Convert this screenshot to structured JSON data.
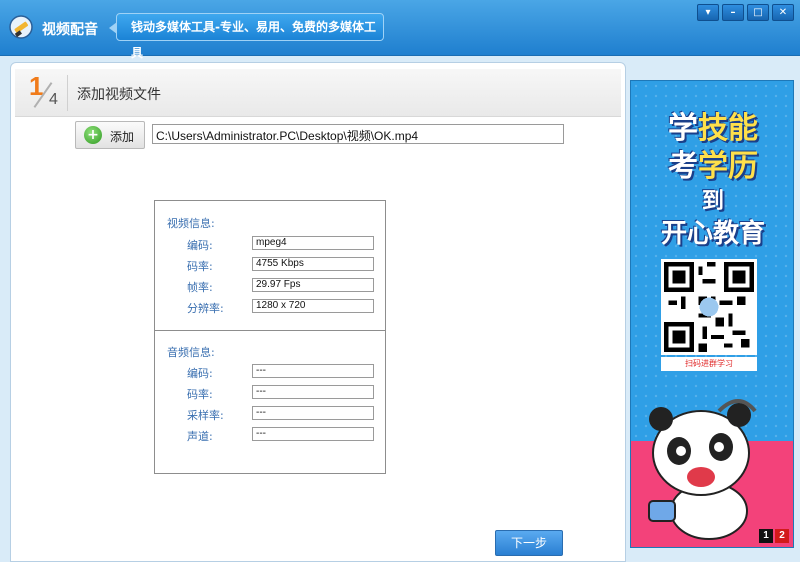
{
  "titlebar": {
    "app_title": "视频配音",
    "slogan": "钱动多媒体工具-专业、易用、免费的多媒体工具",
    "buttons": {
      "menu": "▾",
      "minimize": "–",
      "maximize": "□",
      "close": "✕"
    }
  },
  "step": {
    "current": "1",
    "total": "4",
    "title": "添加视频文件"
  },
  "add_button": {
    "label": "添加",
    "icon": "plus-icon"
  },
  "file_path": "C:\\Users\\Administrator.PC\\Desktop\\视频\\OK.mp4",
  "video_info": {
    "title": "视频信息:",
    "rows": [
      {
        "label": "编码:",
        "value": "mpeg4"
      },
      {
        "label": "码率:",
        "value": "4755 Kbps"
      },
      {
        "label": "帧率:",
        "value": "29.97 Fps"
      },
      {
        "label": "分辨率:",
        "value": "1280 x 720"
      }
    ]
  },
  "audio_info": {
    "title": "音频信息:",
    "rows": [
      {
        "label": "编码:",
        "value": "---"
      },
      {
        "label": "码率:",
        "value": "---"
      },
      {
        "label": "采样率:",
        "value": "---"
      },
      {
        "label": "声道:",
        "value": "---"
      }
    ]
  },
  "next_button": "下一步",
  "ad": {
    "line1_a": "学",
    "line1_b": "技能",
    "line2_a": "考",
    "line2_b": "学历",
    "line3": "到",
    "line4": "开心教育",
    "qr_caption": "扫码进群学习",
    "pages": [
      "1",
      "2"
    ]
  },
  "colors": {
    "accent": "#1f7fcf",
    "step_orange": "#f07b1a",
    "label_blue": "#3a6fb0",
    "ad_bg": "#2f9fe6"
  }
}
